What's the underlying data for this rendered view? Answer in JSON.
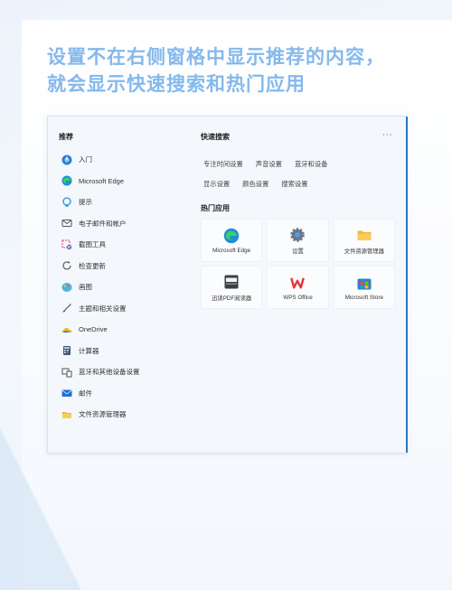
{
  "heading": {
    "line1": "设置不在右侧窗格中显示推荐的内容，",
    "line2": "就会显示快速搜索和热门应用"
  },
  "panel": {
    "recommend_title": "推荐",
    "more_label": "···",
    "recommended": [
      {
        "label": "入门",
        "icon": "get-started-icon"
      },
      {
        "label": "Microsoft Edge",
        "icon": "edge-icon"
      },
      {
        "label": "提示",
        "icon": "tips-icon"
      },
      {
        "label": "电子邮件和帐户",
        "icon": "email-icon"
      },
      {
        "label": "截图工具",
        "icon": "snipping-tool-icon"
      },
      {
        "label": "检查更新",
        "icon": "refresh-icon"
      },
      {
        "label": "画图",
        "icon": "paint-icon"
      },
      {
        "label": "主题和相关设置",
        "icon": "brush-icon"
      },
      {
        "label": "OneDrive",
        "icon": "onedrive-icon"
      },
      {
        "label": "计算器",
        "icon": "calculator-icon"
      },
      {
        "label": "蓝牙和其他设备设置",
        "icon": "devices-icon"
      },
      {
        "label": "邮件",
        "icon": "mail-icon"
      },
      {
        "label": "文件资源管理器",
        "icon": "folder-icon"
      }
    ],
    "quick_title": "快速搜索",
    "quick_rows": [
      [
        "专注时间设置",
        "声音设置",
        "蓝牙和设备"
      ],
      [
        "显示设置",
        "颜色设置",
        "搜索设置"
      ]
    ],
    "hot_title": "热门应用",
    "hot_apps": [
      {
        "label": "Microsoft Edge",
        "icon": "edge-icon"
      },
      {
        "label": "设置",
        "icon": "settings-gear-icon"
      },
      {
        "label": "文件资源管理器",
        "icon": "folder-icon"
      },
      {
        "label": "迅读PDF阅读器",
        "icon": "pdf-reader-icon"
      },
      {
        "label": "WPS Office",
        "icon": "wps-icon"
      },
      {
        "label": "Microsoft Store",
        "icon": "store-icon"
      }
    ]
  },
  "colors": {
    "heading": "#84b9ec",
    "accent_edge": "#2c74c7"
  }
}
